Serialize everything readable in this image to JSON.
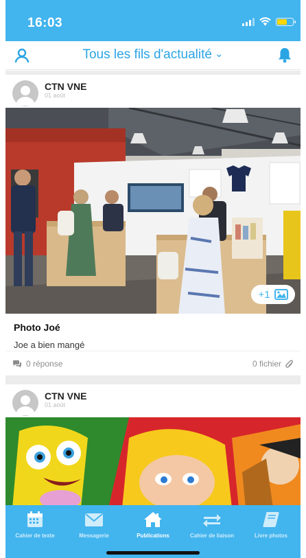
{
  "status_bar": {
    "time": "16:03"
  },
  "nav": {
    "title": "Tous les fils d'actualité"
  },
  "posts": [
    {
      "author": "CTN VNE",
      "date": "01 août",
      "extra_photos": "+1",
      "title": "Photo Joé",
      "text": "Joe a bien mangé",
      "replies": "0 réponse",
      "files": "0 fichier"
    },
    {
      "author": "CTN VNE",
      "date": "01 août"
    }
  ],
  "tabs": [
    {
      "label": "Cahier de texte",
      "icon": "calendar-icon"
    },
    {
      "label": "Messagerie",
      "icon": "envelope-icon"
    },
    {
      "label": "Publications",
      "icon": "home-icon"
    },
    {
      "label": "Cahier de liaison",
      "icon": "swap-arrows-icon"
    },
    {
      "label": "Livre photos",
      "icon": "book-icon"
    }
  ],
  "active_tab": "Publications",
  "colors": {
    "primary": "#42b4ee",
    "title": "#2aa4e3"
  }
}
